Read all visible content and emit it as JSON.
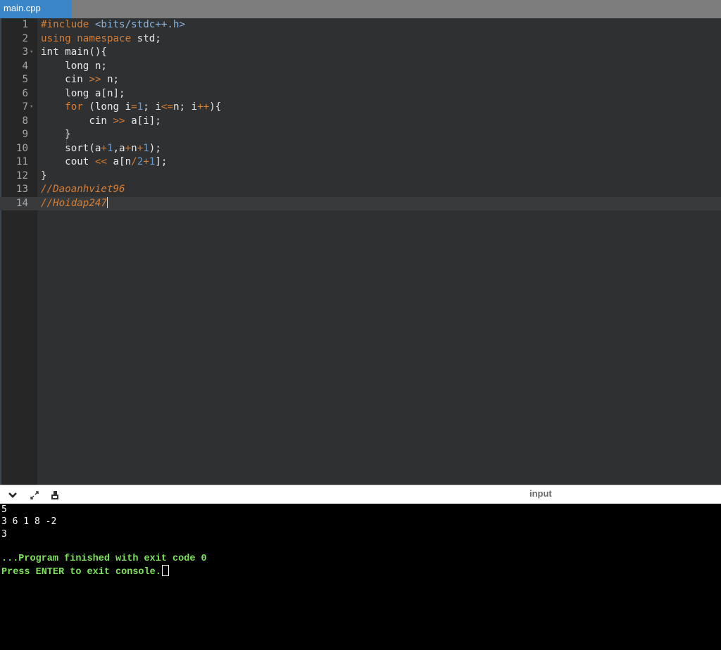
{
  "tab": {
    "label": "main.cpp"
  },
  "editor": {
    "lines": [
      {
        "n": "1",
        "fold": "",
        "segs": [
          {
            "c": "t-pre",
            "t": "#include "
          },
          {
            "c": "t-str",
            "t": "<bits/stdc++.h>"
          }
        ]
      },
      {
        "n": "2",
        "fold": "",
        "segs": [
          {
            "c": "t-kw",
            "t": "using namespace "
          },
          {
            "c": "",
            "t": "std;"
          }
        ]
      },
      {
        "n": "3",
        "fold": "▾",
        "segs": [
          {
            "c": "",
            "t": "int main(){"
          }
        ]
      },
      {
        "n": "4",
        "fold": "",
        "segs": [
          {
            "c": "",
            "t": "    long n;"
          }
        ]
      },
      {
        "n": "5",
        "fold": "",
        "segs": [
          {
            "c": "",
            "t": "    cin "
          },
          {
            "c": "t-op",
            "t": ">>"
          },
          {
            "c": "",
            "t": " n;"
          }
        ]
      },
      {
        "n": "6",
        "fold": "",
        "segs": [
          {
            "c": "",
            "t": "    long a[n];"
          }
        ]
      },
      {
        "n": "7",
        "fold": "▾",
        "segs": [
          {
            "c": "",
            "t": "    "
          },
          {
            "c": "t-kw",
            "t": "for"
          },
          {
            "c": "",
            "t": " (long i"
          },
          {
            "c": "t-op",
            "t": "="
          },
          {
            "c": "t-num",
            "t": "1"
          },
          {
            "c": "",
            "t": "; i"
          },
          {
            "c": "t-op",
            "t": "<="
          },
          {
            "c": "",
            "t": "n; i"
          },
          {
            "c": "t-op",
            "t": "++"
          },
          {
            "c": "",
            "t": "){"
          }
        ]
      },
      {
        "n": "8",
        "fold": "",
        "segs": [
          {
            "c": "",
            "t": "        cin "
          },
          {
            "c": "t-op",
            "t": ">>"
          },
          {
            "c": "",
            "t": " a[i];"
          }
        ]
      },
      {
        "n": "9",
        "fold": "",
        "segs": [
          {
            "c": "",
            "t": "    }"
          }
        ]
      },
      {
        "n": "10",
        "fold": "",
        "segs": [
          {
            "c": "",
            "t": "    sort(a"
          },
          {
            "c": "t-op",
            "t": "+"
          },
          {
            "c": "t-num",
            "t": "1"
          },
          {
            "c": "",
            "t": ",a"
          },
          {
            "c": "t-op",
            "t": "+"
          },
          {
            "c": "",
            "t": "n"
          },
          {
            "c": "t-op",
            "t": "+"
          },
          {
            "c": "t-num",
            "t": "1"
          },
          {
            "c": "",
            "t": ");"
          }
        ]
      },
      {
        "n": "11",
        "fold": "",
        "segs": [
          {
            "c": "",
            "t": "    cout "
          },
          {
            "c": "t-op",
            "t": "<<"
          },
          {
            "c": "",
            "t": " a[n"
          },
          {
            "c": "t-op",
            "t": "/"
          },
          {
            "c": "t-num",
            "t": "2"
          },
          {
            "c": "t-op",
            "t": "+"
          },
          {
            "c": "t-num",
            "t": "1"
          },
          {
            "c": "",
            "t": "];"
          }
        ]
      },
      {
        "n": "12",
        "fold": "",
        "segs": [
          {
            "c": "",
            "t": "}"
          }
        ]
      },
      {
        "n": "13",
        "fold": "",
        "segs": [
          {
            "c": "t-cm",
            "t": "//Daoanhviet96"
          }
        ]
      },
      {
        "n": "14",
        "fold": "",
        "segs": [
          {
            "c": "t-cm",
            "t": "//Hoidap247"
          }
        ]
      }
    ],
    "active_line": "14"
  },
  "console_bar": {
    "icons": [
      "chevron-down-icon",
      "expand-icon",
      "copy-icon"
    ],
    "input_label": "input"
  },
  "console": {
    "lines": [
      {
        "text": "5",
        "style": "plain"
      },
      {
        "text": "3 6 1 8 -2",
        "style": "plain"
      },
      {
        "text": "3",
        "style": "plain"
      },
      {
        "text": "",
        "style": "plain"
      },
      {
        "text": "...Program finished with exit code 0",
        "style": "green"
      },
      {
        "text": "Press ENTER to exit console.",
        "style": "green"
      }
    ]
  },
  "colors": {
    "tab_active": "#3b86c9",
    "keyword": "#d57e36",
    "string": "#8bb5df",
    "number": "#6b9bd1",
    "console_green": "#7ee25a"
  }
}
